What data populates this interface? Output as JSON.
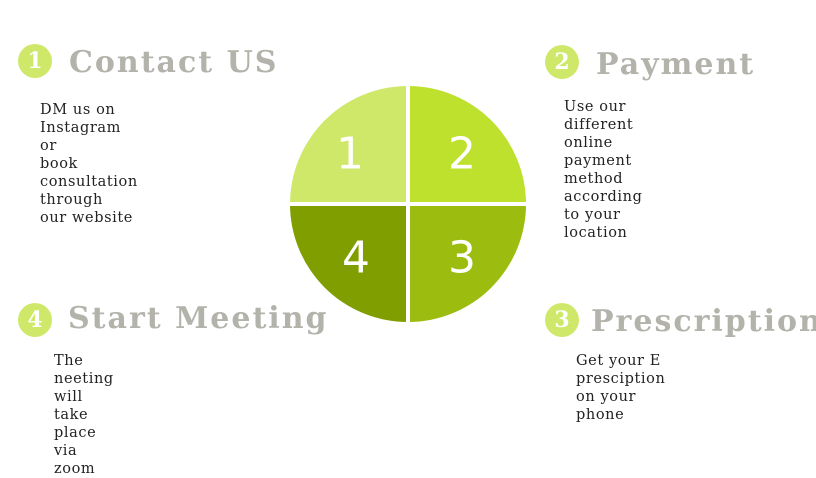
{
  "steps": [
    {
      "number": "1",
      "title": "Contact US",
      "description": "DM us on Instagram or\nbook consultation through\nour website"
    },
    {
      "number": "2",
      "title": "Payment",
      "description": "Use our different online\npayment method according\nto your location"
    },
    {
      "number": "3",
      "title": "Prescription",
      "description": "Get your E presciption\non your phone"
    },
    {
      "number": "4",
      "title": "Start Meeting",
      "description": "The neeting will take place via\nzoom"
    }
  ],
  "wheel": {
    "segments": [
      {
        "label": "1",
        "color": "#cfe86a"
      },
      {
        "label": "2",
        "color": "#bde12d"
      },
      {
        "label": "3",
        "color": "#9cbc10"
      },
      {
        "label": "4",
        "color": "#809e00"
      }
    ]
  }
}
